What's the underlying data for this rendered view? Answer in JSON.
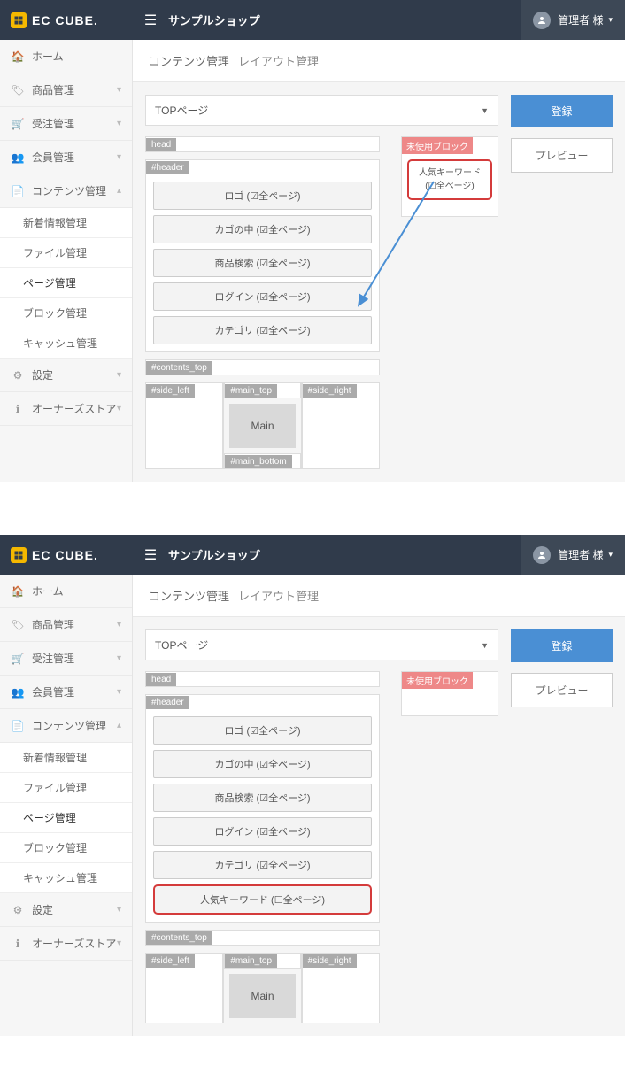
{
  "logo_text": "EC CUBE.",
  "shop_name": "サンプルショップ",
  "user_name": "管理者 様",
  "breadcrumb": {
    "a": "コンテンツ管理",
    "b": "レイアウト管理"
  },
  "nav": [
    {
      "icon": "🏠",
      "label": "ホーム",
      "chev": ""
    },
    {
      "icon": "🏷",
      "label": "商品管理",
      "chev": "▾"
    },
    {
      "icon": "🛒",
      "label": "受注管理",
      "chev": "▾"
    },
    {
      "icon": "👥",
      "label": "会員管理",
      "chev": "▾"
    },
    {
      "icon": "📄",
      "label": "コンテンツ管理",
      "chev": "▴"
    },
    {
      "icon": "⚙",
      "label": "設定",
      "chev": "▾"
    },
    {
      "icon": "ℹ",
      "label": "オーナーズストア",
      "chev": "▾"
    }
  ],
  "subnav": [
    "新着情報管理",
    "ファイル管理",
    "ページ管理",
    "ブロック管理",
    "キャッシュ管理"
  ],
  "select_value": "TOPページ",
  "zones": {
    "head": "head",
    "header": "#header",
    "contents_top": "#contents_top",
    "side_left": "#side_left",
    "main_top": "#main_top",
    "main_bottom": "#main_bottom",
    "side_right": "#side_right",
    "main": "Main",
    "unused": "未使用ブロック"
  },
  "blocks1": [
    "ロゴ (☑全ページ)",
    "カゴの中 (☑全ページ)",
    "商品検索 (☑全ページ)",
    "ログイン (☑全ページ)",
    "カテゴリ (☑全ページ)"
  ],
  "blocks2": [
    "ロゴ (☑全ページ)",
    "カゴの中 (☑全ページ)",
    "商品検索 (☑全ページ)",
    "ログイン (☑全ページ)",
    "カテゴリ (☑全ページ)",
    "人気キーワード (☐全ページ)"
  ],
  "unused_block": {
    "l1": "人気キーワード",
    "l2": "(☐全ページ)"
  },
  "buttons": {
    "register": "登録",
    "preview": "プレビュー"
  }
}
